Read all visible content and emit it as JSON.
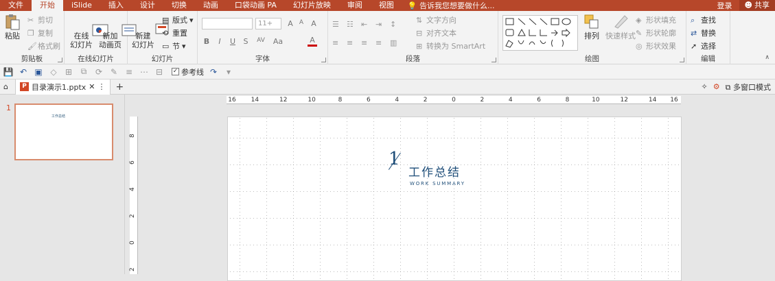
{
  "menu": {
    "tabs": [
      "文件",
      "开始",
      "iSlide",
      "插入",
      "设计",
      "切换",
      "动画",
      "口袋动画 PA",
      "幻灯片放映",
      "审阅",
      "视图"
    ],
    "active_tab": "开始",
    "tell_me": "告诉我您想要做什么...",
    "login": "登录",
    "share": "共享"
  },
  "ribbon": {
    "clipboard": {
      "label": "剪贴板",
      "paste": "粘贴",
      "cut": "剪切",
      "copy": "复制",
      "format_painter": "格式刷"
    },
    "online_slides": {
      "label": "在线幻灯片",
      "online_slide": "在线\n幻灯片",
      "new_animation": "新加\n动画页"
    },
    "slides": {
      "label": "幻灯片",
      "new_slide": "新建\n幻灯片",
      "layout": "版式",
      "reset": "重置",
      "section": "节"
    },
    "font": {
      "label": "字体",
      "size": "11+",
      "bold": "B",
      "italic": "I",
      "underline": "U",
      "strike": "S",
      "spacing": "AV",
      "case": "Aa",
      "color": "A",
      "grow": "A",
      "shrink": "A",
      "clear": "A"
    },
    "paragraph": {
      "label": "段落",
      "text_direction": "文字方向",
      "align_text": "对齐文本",
      "smartart": "转换为 SmartArt"
    },
    "drawing": {
      "label": "绘图",
      "arrange": "排列",
      "quick_styles": "快速样式",
      "shape_fill": "形状填充",
      "shape_outline": "形状轮廓",
      "shape_effects": "形状效果"
    },
    "editing": {
      "label": "编辑",
      "find": "查找",
      "replace": "替换",
      "select": "选择"
    }
  },
  "qat": {
    "reference_line": "参考线"
  },
  "doc_tab": {
    "filename": "目录演示1.pptx",
    "multi_window": "多窗口模式"
  },
  "ruler": {
    "h_ticks": [
      "16",
      "14",
      "12",
      "10",
      "8",
      "6",
      "4",
      "2",
      "0",
      "2",
      "4",
      "6",
      "8",
      "10",
      "12",
      "14",
      "16"
    ],
    "v_ticks": [
      "8",
      "6",
      "4",
      "2",
      "0",
      "2"
    ]
  },
  "thumbnail": {
    "number": "1",
    "text": "工作总结"
  },
  "slide": {
    "number": "1",
    "title": "工作总结",
    "subtitle": "WORK SUMMARY"
  }
}
